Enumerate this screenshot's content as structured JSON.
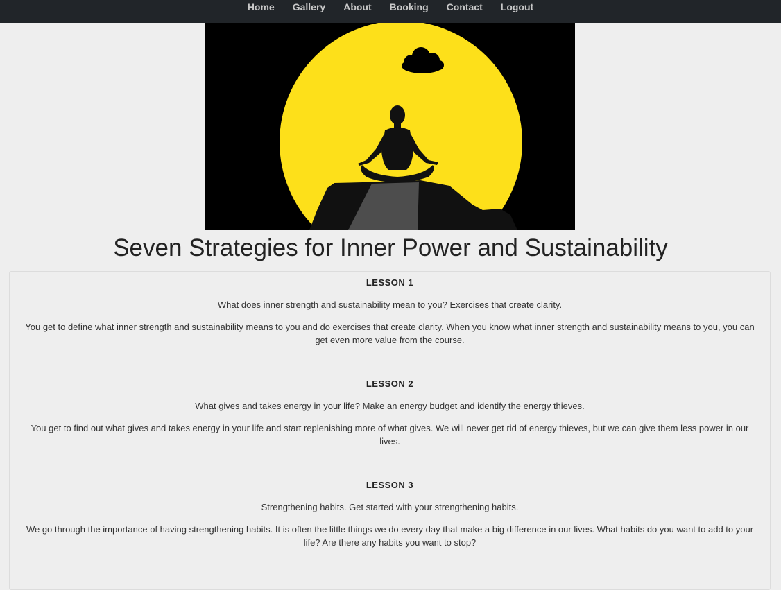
{
  "nav": {
    "items": [
      {
        "label": "Home"
      },
      {
        "label": "Gallery"
      },
      {
        "label": "About"
      },
      {
        "label": "Booking"
      },
      {
        "label": "Contact"
      },
      {
        "label": "Logout"
      }
    ]
  },
  "hero": {
    "colors": {
      "background": "#000000",
      "sun": "#fde01a",
      "rock": "#1a1a1a",
      "path": "#4a4a4a"
    }
  },
  "page": {
    "title": "Seven Strategies for Inner Power and Sustainability"
  },
  "lessons": [
    {
      "title": "LESSON 1",
      "summary": "What does inner strength and sustainability mean to you? Exercises that create clarity.",
      "body": "You get to define what inner strength and sustainability means to you and do exercises that create clarity. When you know what inner strength and sustainability means to you, you can get even more value from the course."
    },
    {
      "title": "LESSON 2",
      "summary": "What gives and takes energy in your life? Make an energy budget and identify the energy thieves.",
      "body": "You get to find out what gives and takes energy in your life and start replenishing more of what gives. We will never get rid of energy thieves, but we can give them less power in our lives."
    },
    {
      "title": "LESSON 3",
      "summary": "Strengthening habits. Get started with your strengthening habits.",
      "body": "We go through the importance of having strengthening habits. It is often the little things we do every day that make a big difference in our lives. What habits do you want to add to your life? Are there any habits you want to stop?"
    }
  ]
}
